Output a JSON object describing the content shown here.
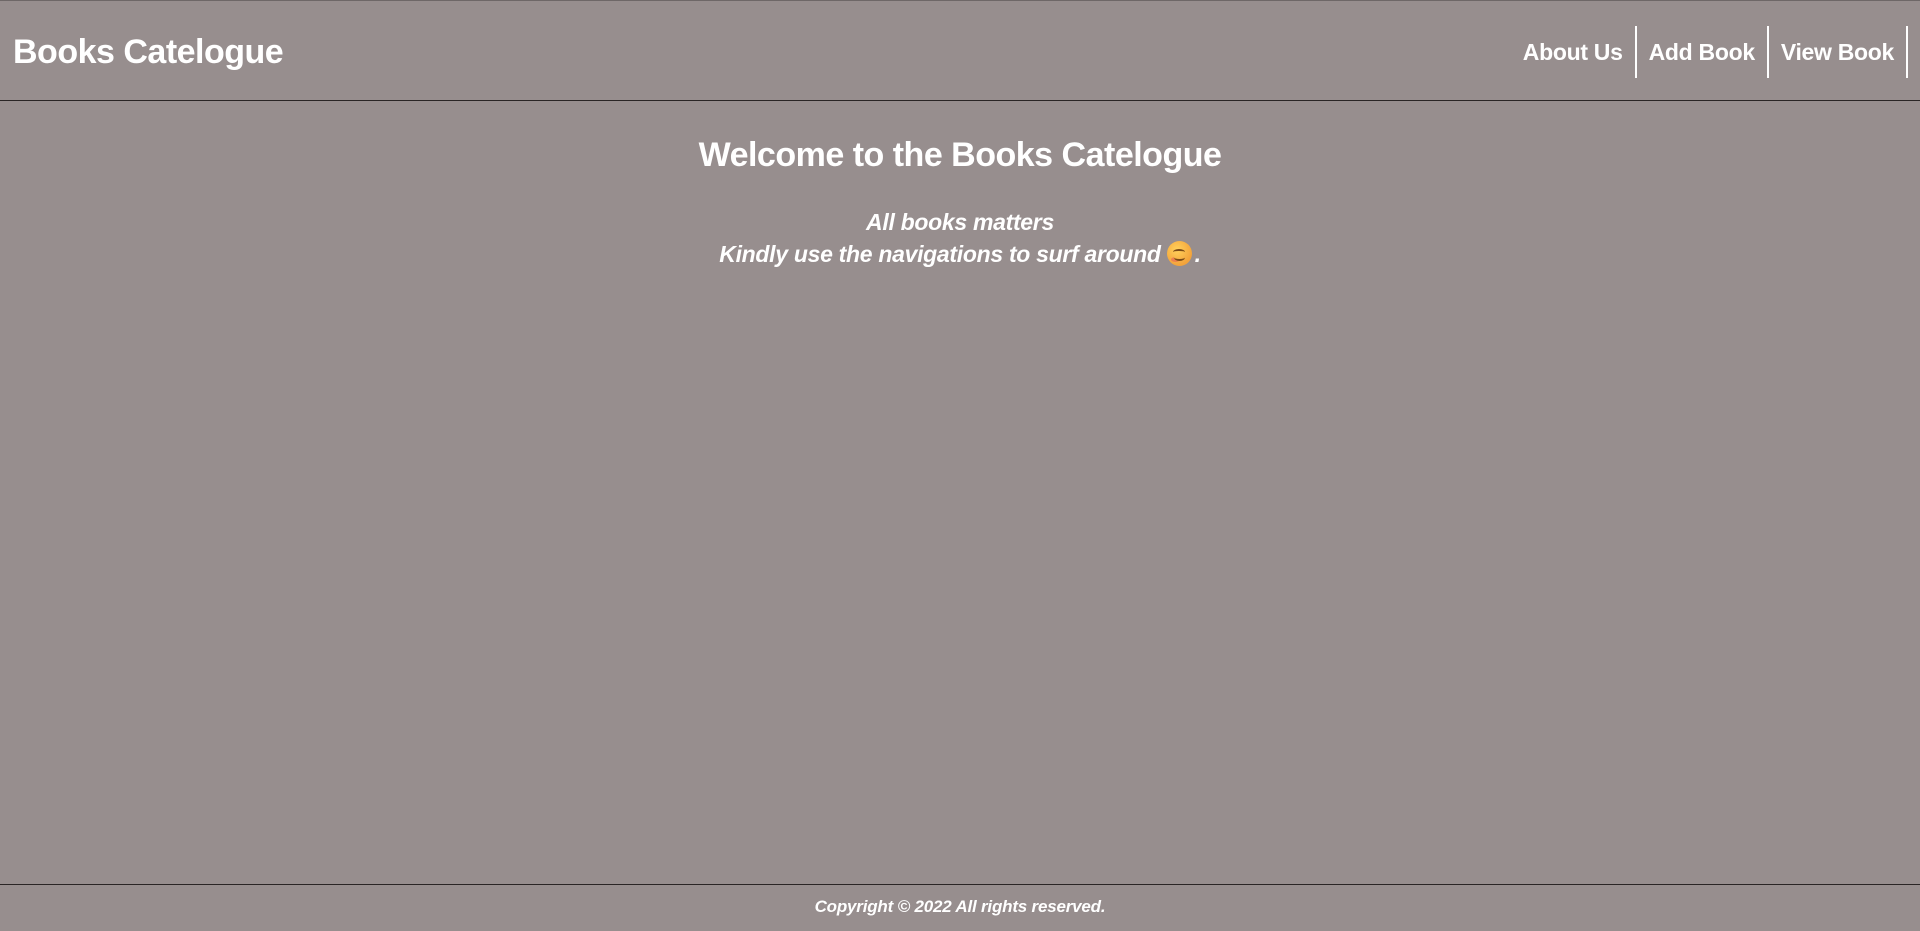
{
  "header": {
    "brand": "Books Catelogue",
    "nav": [
      {
        "label": "About Us"
      },
      {
        "label": "Add Book"
      },
      {
        "label": "View Book"
      }
    ]
  },
  "main": {
    "title": "Welcome to the Books Catelogue",
    "line1": "All books matters",
    "line2": "Kindly use the navigations to surf around",
    "line2_suffix": ".",
    "emoji_icon": "smiling-face-icon"
  },
  "footer": {
    "text": "Copyright © 2022 All rights reserved."
  },
  "colors": {
    "background": "#978e8e",
    "text": "#ffffff"
  }
}
